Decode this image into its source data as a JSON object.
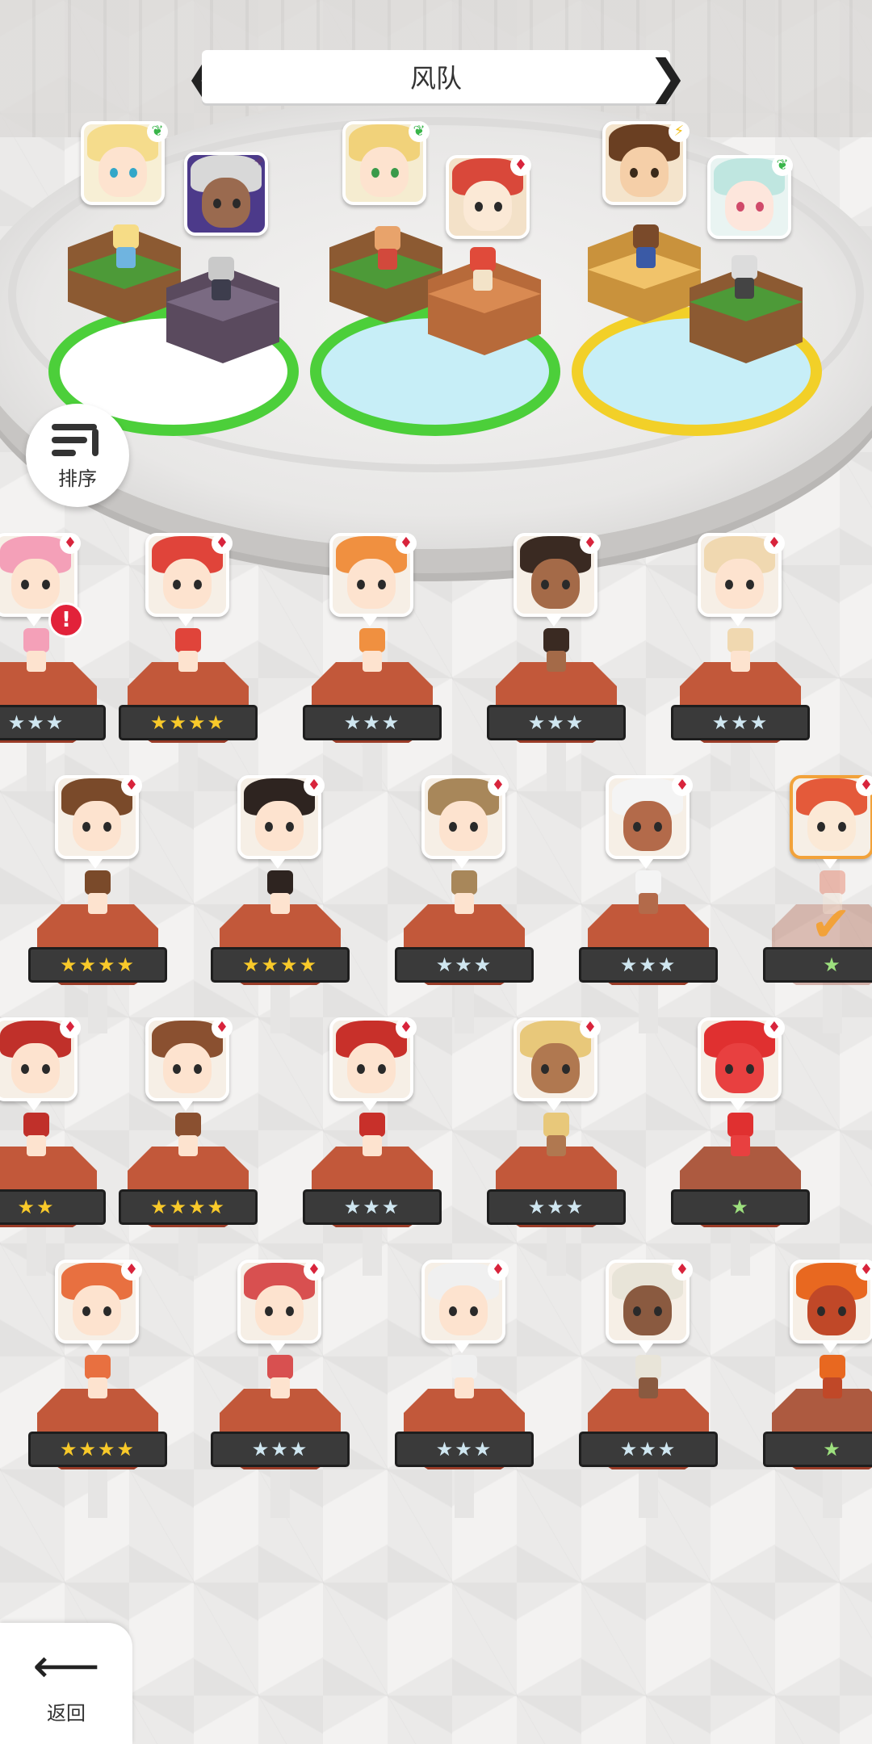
{
  "header": {
    "title": "风队"
  },
  "controls": {
    "sort_label": "排序",
    "back_label": "返回"
  },
  "colors": {
    "team1_ring": "#4ccf3a",
    "team2_ring": "#4ccf3a",
    "team3_ring": "#f2d028",
    "pedestal": "#c2583a",
    "gold_star": "#f8c92a",
    "alert": "#e2223a",
    "selected": "#f2a23a"
  },
  "teams": [
    {
      "slot": 1,
      "members": [
        {
          "element": "wind",
          "icon": "leaf-icon"
        },
        {
          "element": "dark",
          "icon": "star-sparkle-icon"
        }
      ]
    },
    {
      "slot": 2,
      "members": [
        {
          "element": "wind",
          "icon": "leaf-icon"
        },
        {
          "element": "fire",
          "icon": "fire-icon"
        }
      ]
    },
    {
      "slot": 3,
      "members": [
        {
          "element": "lightning",
          "icon": "bolt-icon"
        },
        {
          "element": "wind",
          "icon": "leaf-icon"
        }
      ]
    }
  ],
  "roster": [
    {
      "stars": 3,
      "rank": "silver",
      "element": "fire",
      "alert": "!"
    },
    {
      "stars": 4,
      "rank": "gold",
      "element": "fire"
    },
    {
      "stars": 3,
      "rank": "silver",
      "element": "fire"
    },
    {
      "stars": 3,
      "rank": "silver",
      "element": "fire"
    },
    {
      "stars": 3,
      "rank": "silver",
      "element": "fire"
    },
    {
      "stars": 4,
      "rank": "gold",
      "element": "fire"
    },
    {
      "stars": 4,
      "rank": "gold",
      "element": "fire"
    },
    {
      "stars": 3,
      "rank": "silver",
      "element": "fire"
    },
    {
      "stars": 3,
      "rank": "silver",
      "element": "fire"
    },
    {
      "stars": 1,
      "rank": "green",
      "element": "fire",
      "selected": true
    },
    {
      "stars": 2,
      "rank": "gold",
      "element": "fire"
    },
    {
      "stars": 4,
      "rank": "gold",
      "element": "fire"
    },
    {
      "stars": 3,
      "rank": "silver",
      "element": "fire"
    },
    {
      "stars": 3,
      "rank": "silver",
      "element": "fire"
    },
    {
      "stars": 1,
      "rank": "green",
      "element": "fire"
    },
    {
      "stars": 4,
      "rank": "gold",
      "element": "fire"
    },
    {
      "stars": 3,
      "rank": "silver",
      "element": "fire"
    },
    {
      "stars": 3,
      "rank": "silver",
      "element": "fire"
    },
    {
      "stars": 3,
      "rank": "silver",
      "element": "fire"
    },
    {
      "stars": 1,
      "rank": "green",
      "element": "fire"
    }
  ],
  "glyphs": {
    "star": "★",
    "fire": "♦",
    "leaf": "❦",
    "bolt": "⚡",
    "sparkle": "✦",
    "check": "✔",
    "arrow_left": "⟵",
    "chev_left": "❮",
    "chev_right": "❯"
  }
}
